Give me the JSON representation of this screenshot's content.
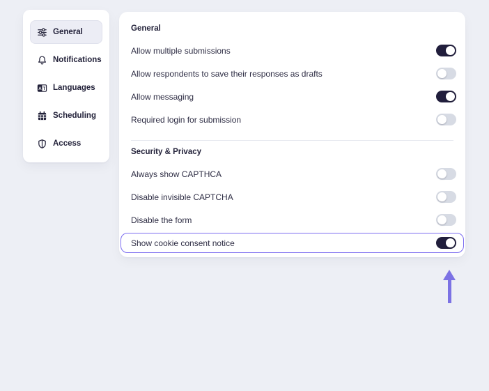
{
  "colors": {
    "page_bg": "#edeff5",
    "card_bg": "#ffffff",
    "text_dark": "#23223a",
    "text_label": "#2e2d44",
    "accent": "#7b6cf0",
    "arrow": "#7c72e4",
    "toggle_on": "#211e3c",
    "toggle_off": "#d7dbe4",
    "divider": "#e7e9f0",
    "active_item_bg": "#ecedf5",
    "active_item_border": "#dfe1ec"
  },
  "sidebar": {
    "items": [
      {
        "label": "General",
        "icon": "sliders-icon",
        "active": true
      },
      {
        "label": "Notifications",
        "icon": "bell-icon",
        "active": false
      },
      {
        "label": "Languages",
        "icon": "translate-icon",
        "active": false
      },
      {
        "label": "Scheduling",
        "icon": "calendar-icon",
        "active": false
      },
      {
        "label": "Access",
        "icon": "shield-icon",
        "active": false
      }
    ]
  },
  "settings": {
    "sections": [
      {
        "title": "General",
        "rows": [
          {
            "label": "Allow multiple submissions",
            "on": true,
            "highlighted": false
          },
          {
            "label": "Allow respondents to save their responses as drafts",
            "on": false,
            "highlighted": false
          },
          {
            "label": "Allow messaging",
            "on": true,
            "highlighted": false
          },
          {
            "label": "Required login for submission",
            "on": false,
            "highlighted": false
          }
        ]
      },
      {
        "title": "Security & Privacy",
        "rows": [
          {
            "label": "Always show CAPTHCA",
            "on": false,
            "highlighted": false
          },
          {
            "label": "Disable invisible CAPTCHA",
            "on": false,
            "highlighted": false
          },
          {
            "label": "Disable the form",
            "on": false,
            "highlighted": false
          },
          {
            "label": "Show cookie consent notice",
            "on": true,
            "highlighted": true
          }
        ]
      }
    ]
  },
  "annotation": {
    "arrow_icon": "arrow-up-icon",
    "points_to": "Show cookie consent notice"
  }
}
